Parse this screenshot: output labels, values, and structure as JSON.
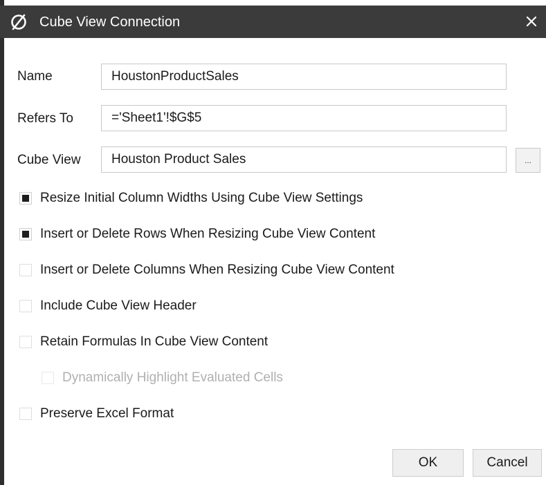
{
  "window": {
    "title": "Cube View Connection",
    "logo_icon": "slashed-circle-logo-icon",
    "close_label": "✕"
  },
  "form": {
    "name_label": "Name",
    "name_value": "HoustonProductSales",
    "refers_to_label": "Refers To",
    "refers_to_value": "='Sheet1'!$G$5",
    "cube_view_label": "Cube View",
    "cube_view_value": "Houston Product Sales",
    "browse_label": "..."
  },
  "options": [
    {
      "label": "Resize Initial Column Widths Using Cube View Settings",
      "checked": true,
      "enabled": true
    },
    {
      "label": "Insert or Delete Rows When Resizing Cube View Content",
      "checked": true,
      "enabled": true
    },
    {
      "label": "Insert or Delete Columns When Resizing Cube View Content",
      "checked": false,
      "enabled": true
    },
    {
      "label": "Include Cube View Header",
      "checked": false,
      "enabled": true
    },
    {
      "label": "Retain Formulas In Cube View Content",
      "checked": false,
      "enabled": true
    },
    {
      "label": "Dynamically Highlight Evaluated Cells",
      "checked": false,
      "enabled": false
    },
    {
      "label": "Preserve Excel Format",
      "checked": false,
      "enabled": true
    }
  ],
  "buttons": {
    "ok_label": "OK",
    "cancel_label": "Cancel"
  },
  "colors": {
    "titlebar": "#3b3b3b",
    "title_text": "#ffffff",
    "disabled_text": "#b0b0b0"
  }
}
